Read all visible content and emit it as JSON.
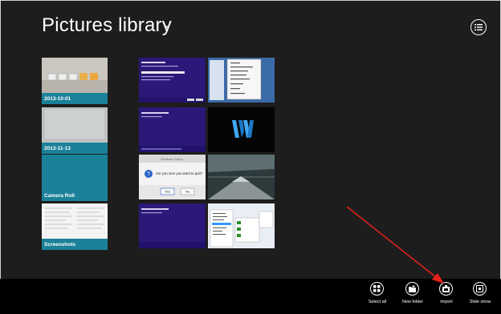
{
  "header": {
    "title": "Pictures library"
  },
  "folders": [
    {
      "label": "2013-10-01"
    },
    {
      "label": "2013-11-13"
    },
    {
      "label": "Camera Roll"
    },
    {
      "label": "Screenshots"
    }
  ],
  "thumbnails": {
    "dialog_text": "Are you sure you want to quit?",
    "yes": "Yes",
    "no": "No",
    "setup_title": "Windows Setup"
  },
  "appbar": {
    "select_all": "Select all",
    "new_folder": "New folder",
    "import": "Import",
    "slide_show": "Slide show"
  },
  "colors": {
    "background": "#1d1d1d",
    "folder_tile": "#1a8199",
    "arrow": "#e8201c"
  }
}
